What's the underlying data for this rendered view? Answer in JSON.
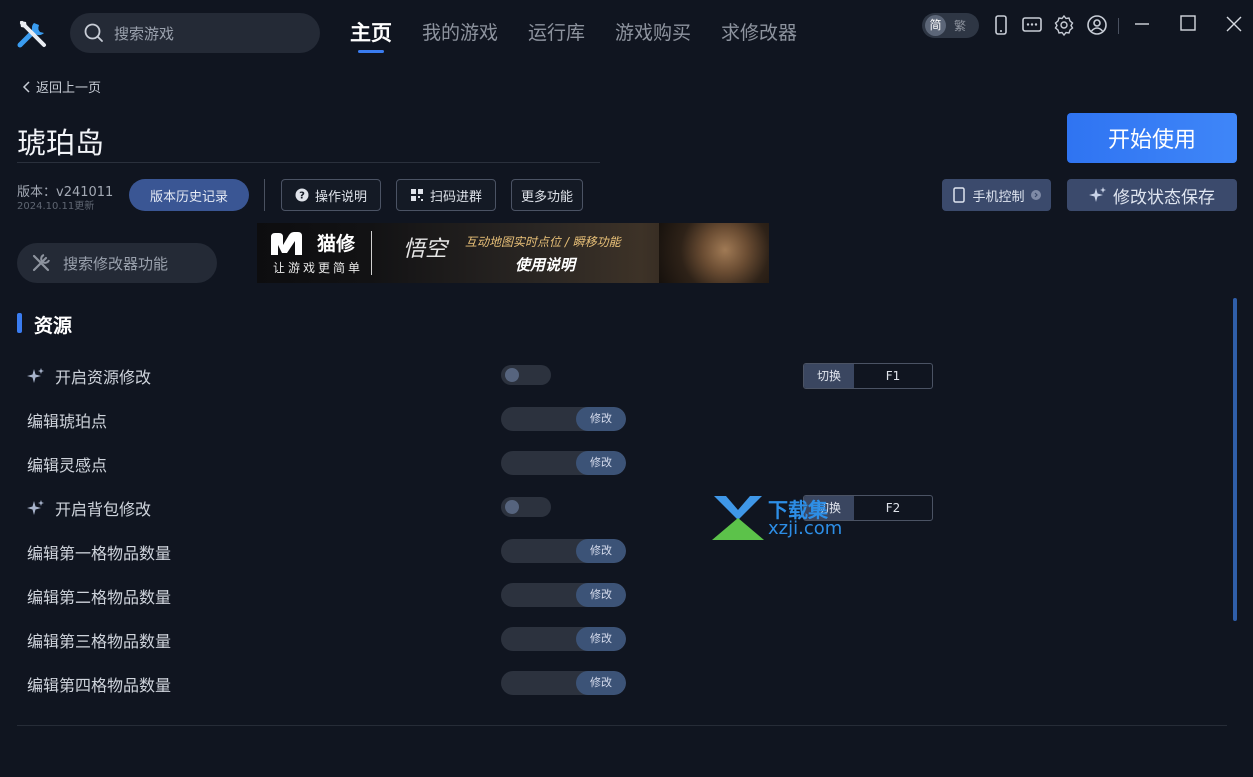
{
  "app": {
    "search_placeholder": "搜索游戏",
    "nav": [
      {
        "label": "主页",
        "active": true
      },
      {
        "label": "我的游戏"
      },
      {
        "label": "运行库"
      },
      {
        "label": "游戏购买"
      },
      {
        "label": "求修改器"
      }
    ],
    "lang": {
      "simplified": "简",
      "traditional": "繁"
    }
  },
  "page": {
    "back_label": "返回上一页",
    "game_title": "琥珀岛",
    "version": "版本：v241011",
    "version_date": "2024.10.11更新",
    "history_button": "版本历史记录",
    "help_button": "操作说明",
    "qr_button": "扫码进群",
    "more_button": "更多功能",
    "start_button": "开始使用",
    "phone_control_button": "手机控制",
    "save_state_button": "修改状态保存",
    "feature_search_placeholder": "搜索修改器功能"
  },
  "banner": {
    "brand": "猫修",
    "brand_sub": "让游戏更简单",
    "tagline": "互动地图实时点位 / 瞬移功能",
    "cta": "使用说明"
  },
  "section": {
    "title": "资源",
    "rows": [
      {
        "label": "开启资源修改",
        "type": "toggle",
        "star": true,
        "on": false,
        "hotkey_action": "切换",
        "hotkey": "F1"
      },
      {
        "label": "编辑琥珀点",
        "type": "edit",
        "button": "修改"
      },
      {
        "label": "编辑灵感点",
        "type": "edit",
        "button": "修改"
      },
      {
        "label": "开启背包修改",
        "type": "toggle",
        "star": true,
        "on": false,
        "hotkey_action": "切换",
        "hotkey": "F2"
      },
      {
        "label": "编辑第一格物品数量",
        "type": "edit",
        "button": "修改"
      },
      {
        "label": "编辑第二格物品数量",
        "type": "edit",
        "button": "修改"
      },
      {
        "label": "编辑第三格物品数量",
        "type": "edit",
        "button": "修改"
      },
      {
        "label": "编辑第四格物品数量",
        "type": "edit",
        "button": "修改"
      }
    ]
  },
  "watermark": {
    "line1": "下载集",
    "line2": "xzji.com"
  },
  "colors": {
    "accent": "#3a7cf0",
    "background": "#101520",
    "start_button": "#2f74f2"
  }
}
